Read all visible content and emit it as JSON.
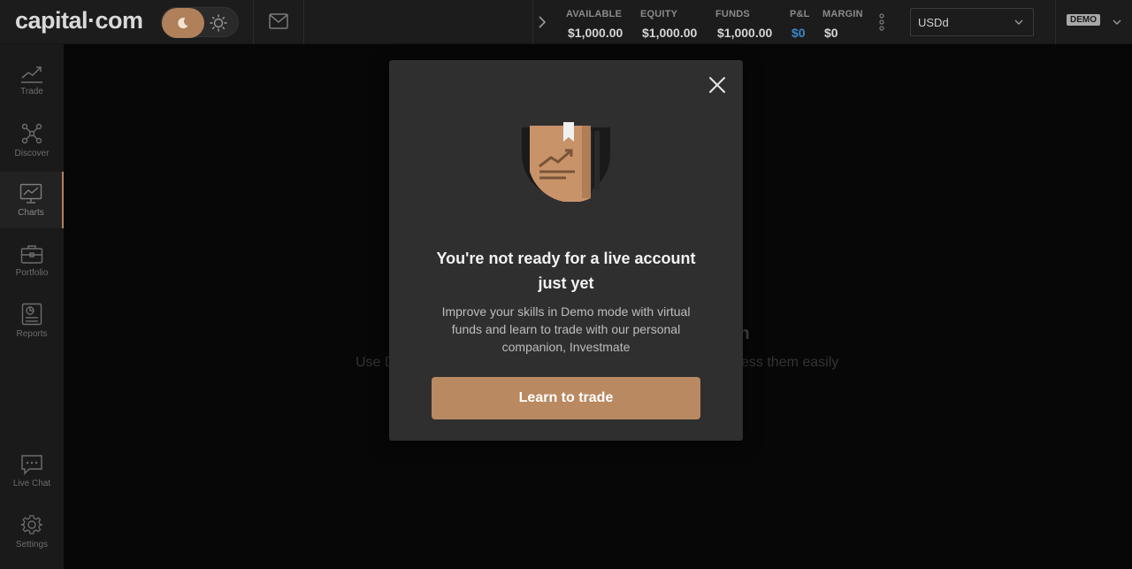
{
  "header": {
    "logo": "capital·com",
    "stats": [
      {
        "label": "AVAILABLE",
        "value": "$1,000.00"
      },
      {
        "label": "EQUITY",
        "value": "$1,000.00"
      },
      {
        "label": "FUNDS",
        "value": "$1,000.00"
      },
      {
        "label": "P&L",
        "value": "$0"
      },
      {
        "label": "MARGIN",
        "value": "$0"
      }
    ],
    "account_select": "USDd",
    "mode_badge": "DEMO"
  },
  "sidebar": {
    "items": [
      {
        "label": "Trade",
        "icon": "trend-line-icon"
      },
      {
        "label": "Discover",
        "icon": "network-icon"
      },
      {
        "label": "Charts",
        "icon": "monitor-chart-icon",
        "active": true
      },
      {
        "label": "Portfolio",
        "icon": "briefcase-icon"
      },
      {
        "label": "Reports",
        "icon": "report-icon"
      }
    ],
    "bottom_items": [
      {
        "label": "Live Chat",
        "icon": "chat-icon"
      },
      {
        "label": "Settings",
        "icon": "gear-icon"
      }
    ]
  },
  "background": {
    "title_fragment": "ction",
    "subtitle_left": "Use D",
    "subtitle_right": "ess them easily"
  },
  "modal": {
    "title": "You're not ready for a live account just yet",
    "body": "Improve your skills in Demo mode with virtual funds and learn to trade with our personal companion, Investmate",
    "cta_label": "Learn to trade"
  },
  "colors": {
    "accent": "#b98a62",
    "pnl_blue": "#3a86c8",
    "modal_bg": "#2f2f2f"
  }
}
